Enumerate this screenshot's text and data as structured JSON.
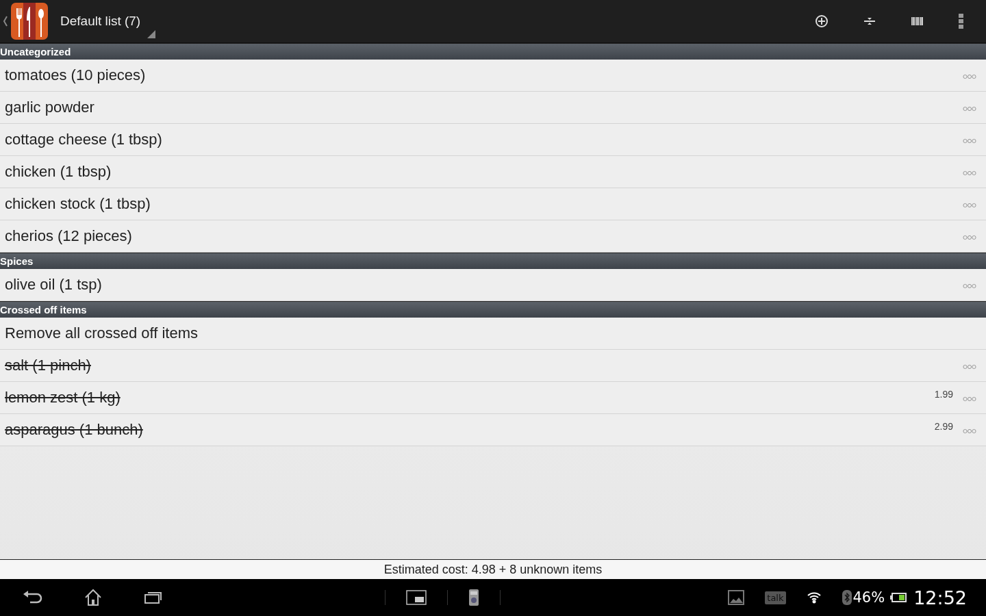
{
  "action_bar": {
    "title": "Default list (7)"
  },
  "sections": [
    {
      "title": "Uncategorized",
      "items": [
        {
          "kind": "item",
          "label": "tomatoes (10 pieces)",
          "crossed": false
        },
        {
          "kind": "item",
          "label": "garlic powder",
          "crossed": false
        },
        {
          "kind": "item",
          "label": "cottage cheese (1 tbsp)",
          "crossed": false
        },
        {
          "kind": "item",
          "label": "chicken (1 tbsp)",
          "crossed": false
        },
        {
          "kind": "item",
          "label": "chicken stock (1 tbsp)",
          "crossed": false
        },
        {
          "kind": "item",
          "label": "cherios (12 pieces)",
          "crossed": false
        }
      ]
    },
    {
      "title": "Spices",
      "items": [
        {
          "kind": "item",
          "label": "olive oil (1 tsp)",
          "crossed": false
        }
      ]
    },
    {
      "title": "Crossed off items",
      "items": [
        {
          "kind": "action",
          "label": "Remove all crossed off items"
        },
        {
          "kind": "item",
          "label": "salt (1 pinch)",
          "crossed": true
        },
        {
          "kind": "item",
          "label": "lemon zest (1 kg)",
          "crossed": true,
          "price": "1.99"
        },
        {
          "kind": "item",
          "label": "asparagus (1 bunch)",
          "crossed": true,
          "price": "2.99"
        }
      ]
    }
  ],
  "footer": "Estimated cost: 4.98 + 8 unknown items",
  "status_bar": {
    "notification": "talk",
    "battery": "46%",
    "time": "12:52"
  }
}
